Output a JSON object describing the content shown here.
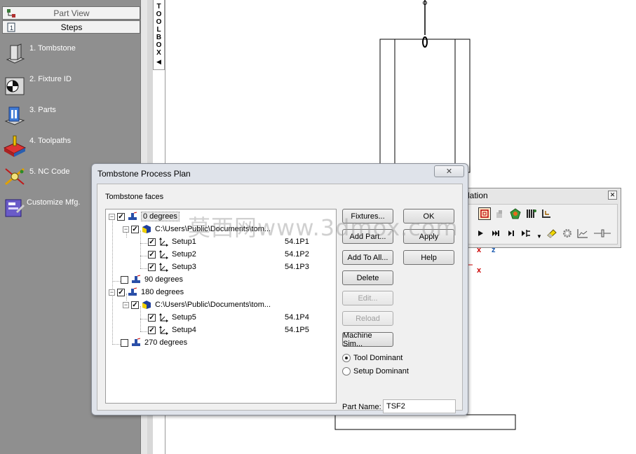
{
  "left_panel": {
    "part_view_label": "Part View",
    "steps_label": "Steps",
    "steps": [
      {
        "label": "1.  Tombstone",
        "icon": "tombstone-icon"
      },
      {
        "label": "2.  Fixture ID",
        "icon": "fixture-id-icon"
      },
      {
        "label": "3.  Parts",
        "icon": "parts-icon"
      },
      {
        "label": "4.  Toolpaths",
        "icon": "toolpaths-icon"
      },
      {
        "label": "5.  NC Code",
        "icon": "nc-code-icon"
      },
      {
        "label": "Customize Mfg.",
        "icon": "customize-mfg-icon"
      }
    ]
  },
  "toolbox": {
    "letters": [
      "T",
      "O",
      "O",
      "L",
      "B",
      "O",
      "X"
    ],
    "arrow": "◀"
  },
  "dialog": {
    "title": "Tombstone Process Plan",
    "close_glyph": "✕",
    "faces_label": "Tombstone faces",
    "tree": [
      {
        "label": "0 degrees",
        "expander": "−",
        "checked": true,
        "selected": true
      },
      {
        "label": "C:\\Users\\Public\\Documents\\tom...",
        "expander": "−",
        "checked": true
      },
      {
        "label": "Setup1",
        "value": "54.1P1",
        "checked": true
      },
      {
        "label": "Setup2",
        "value": "54.1P2",
        "checked": true
      },
      {
        "label": "Setup3",
        "value": "54.1P3",
        "checked": true
      },
      {
        "label": "90 degrees",
        "checked": false
      },
      {
        "label": "180 degrees",
        "expander": "−",
        "checked": true
      },
      {
        "label": "C:\\Users\\Public\\Documents\\tom...",
        "expander": "−",
        "checked": true
      },
      {
        "label": "Setup5",
        "value": "54.1P4",
        "checked": true
      },
      {
        "label": "Setup4",
        "value": "54.1P5",
        "checked": true
      },
      {
        "label": "270 degrees",
        "checked": false
      }
    ],
    "buttons": {
      "fixtures": "Fixtures...",
      "add_part": "Add Part...",
      "add_to_all": "Add To All...",
      "delete": "Delete",
      "edit": "Edit...",
      "reload": "Reload",
      "machine_sim": "Machine Sim...",
      "ok": "OK",
      "apply": "Apply",
      "help": "Help"
    },
    "radio": {
      "tool_dominant": "Tool Dominant",
      "setup_dominant": "Setup Dominant",
      "selected": "tool_dominant"
    },
    "part_name_label": "Part Name:",
    "part_name_value": "TSF2"
  },
  "sim_toolbar": {
    "title_fragment": "lation",
    "close_glyph": "✕"
  },
  "canvas": {
    "axis_x": "x",
    "axis_z": "z"
  },
  "watermark": "莫西网www.3dmox.com",
  "colors": {
    "panel_bg": "#8f8f8f",
    "dialog_bg": "#dfe3ea",
    "body_bg": "#f0f0f0"
  }
}
